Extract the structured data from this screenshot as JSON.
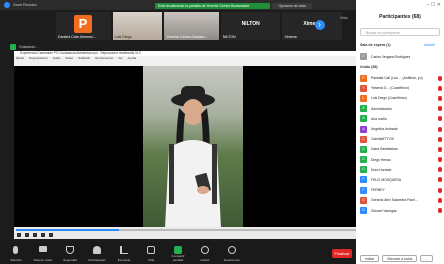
{
  "window": {
    "title": "Zoom Reunión"
  },
  "banner": {
    "text": "Está visualizando la pantalla de Yesenia Gómez Bustamante",
    "view_options": "Opciones de vista"
  },
  "participants_strip": [
    {
      "name": "Daniela Cala Jimenez...",
      "initial": "P"
    },
    {
      "name": "Luis Diego"
    },
    {
      "name": "Yesenia Gómez Bustam..."
    },
    {
      "name": "NILTON",
      "big": "NILTON"
    },
    {
      "name": "Ximena",
      "big": "Ximena"
    }
  ],
  "side_view_label": "Vista",
  "status": {
    "text": "Grabando..."
  },
  "player": {
    "title": "Experiencia Caminante PG Ciudadanía Ambiental.mp4 - Reproductor multimedia VLC",
    "menu": [
      "Medio",
      "Reproducción",
      "Audio",
      "Vídeo",
      "Subtítulo",
      "Herramientas",
      "Ver",
      "Ayuda"
    ],
    "progress": 0.3
  },
  "toolbar": {
    "items": [
      {
        "label": "Silenciar",
        "icon": "mic-icon"
      },
      {
        "label": "Detener video",
        "icon": "video-icon"
      },
      {
        "label": "Seguridad",
        "icon": "shield-icon"
      },
      {
        "label": "Participantes",
        "icon": "participants-icon"
      },
      {
        "label": "Encuesta",
        "icon": "poll-icon"
      },
      {
        "label": "Chat",
        "icon": "chat-icon"
      },
      {
        "label": "Compartir pantalla",
        "icon": "share-icon"
      },
      {
        "label": "Grabar",
        "icon": "record-icon"
      },
      {
        "label": "Reacciones",
        "icon": "reactions-icon"
      }
    ],
    "end_label": "Finalizar"
  },
  "panel": {
    "title": "Participantes (68)",
    "search_placeholder": "Buscar un participante",
    "waiting_section": "Sala de espera (1)",
    "waiting_action": "Admitir",
    "waiting_person": "Carlos Vergara Rodríguez",
    "in_meeting_section": "Unido (58)",
    "participants": [
      {
        "name": "Pantalla Cali (Lau ... (Anfitrión, yo)",
        "color": "#f26d21",
        "initial": "P"
      },
      {
        "name": "Yesenia G... (Coanfitrión)",
        "color": "#e0533d",
        "initial": "Y"
      },
      {
        "name": "Luis Diego (Coanfitrión)",
        "color": "#f26d21",
        "initial": "L"
      },
      {
        "name": "Administrador",
        "color": "#23b14d",
        "initial": "A"
      },
      {
        "name": "Ana coello",
        "color": "#23b14d",
        "initial": "A"
      },
      {
        "name": "Angélica Andrade",
        "color": "#8f3fd1",
        "initial": "A"
      },
      {
        "name": "CamilaMTTVIII",
        "color": "#e0533d",
        "initial": "C"
      },
      {
        "name": "Daira Santisteban",
        "color": "#23b14d",
        "initial": "D"
      },
      {
        "name": "Diego Henao",
        "color": "#23b14d",
        "initial": "D"
      },
      {
        "name": "Dora Hurtado",
        "color": "#23b14d",
        "initial": "D"
      },
      {
        "name": "FÉLIX MOSQUERA",
        "color": "#2d8cff",
        "initial": "F"
      },
      {
        "name": "FERNEY",
        "color": "#2d8cff",
        "initial": "F"
      },
      {
        "name": "Gerardo Alex Saavedra Pach...",
        "color": "#e0533d",
        "initial": "G"
      },
      {
        "name": "Giovani Vanegas",
        "color": "#2d8cff",
        "initial": "G"
      }
    ],
    "footer": {
      "invite": "Invitar",
      "mute_all": "Silenciar a todos",
      "more": "..."
    }
  }
}
